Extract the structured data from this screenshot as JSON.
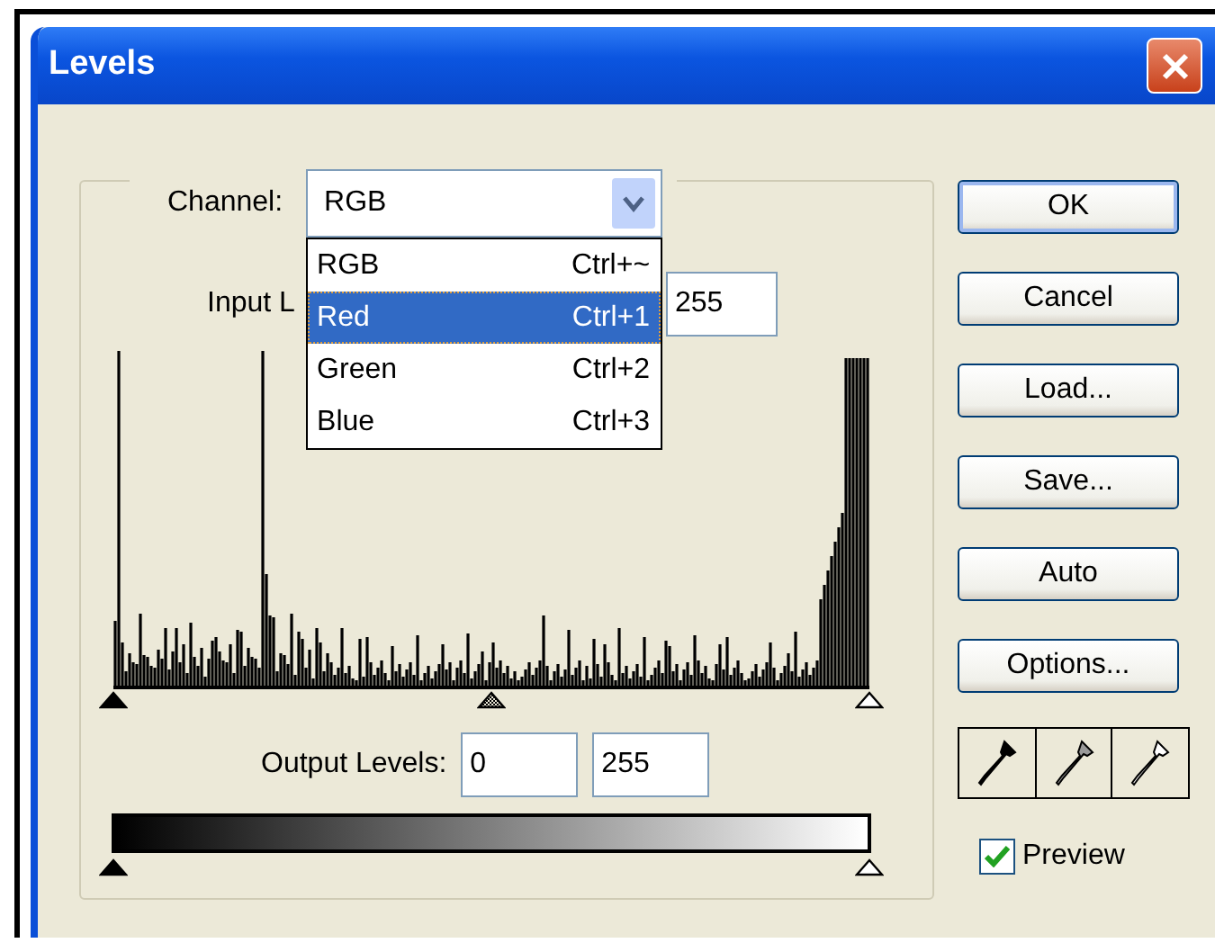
{
  "window": {
    "title": "Levels"
  },
  "channel": {
    "label": "Channel:",
    "value": "RGB",
    "dropdown_open": true
  },
  "channel_menu": [
    {
      "label": "RGB",
      "shortcut": "Ctrl+~",
      "selected": false
    },
    {
      "label": "Red",
      "shortcut": "Ctrl+1",
      "selected": true
    },
    {
      "label": "Green",
      "shortcut": "Ctrl+2",
      "selected": false
    },
    {
      "label": "Blue",
      "shortcut": "Ctrl+3",
      "selected": false
    }
  ],
  "input_levels": {
    "label": "Input L",
    "fields": [
      "255"
    ],
    "sliders": [
      {
        "kind": "black",
        "level": 0
      },
      {
        "kind": "gray",
        "level": 0.5
      },
      {
        "kind": "white",
        "level": 1
      }
    ]
  },
  "output_levels": {
    "label": "Output Levels:",
    "fields": [
      "0",
      "255"
    ],
    "sliders": [
      {
        "kind": "black"
      },
      {
        "kind": "white"
      }
    ]
  },
  "buttons": [
    {
      "label": "OK",
      "default": true
    },
    {
      "label": "Cancel",
      "default": false
    },
    {
      "label": "Load...",
      "default": false
    },
    {
      "label": "Save...",
      "default": false
    },
    {
      "label": "Auto",
      "default": false
    },
    {
      "label": "Options...",
      "default": false
    }
  ],
  "eyedroppers": [
    {
      "kind": "black"
    },
    {
      "kind": "gray"
    },
    {
      "kind": "white"
    }
  ],
  "preview": {
    "label": "Preview",
    "checked": true
  }
}
